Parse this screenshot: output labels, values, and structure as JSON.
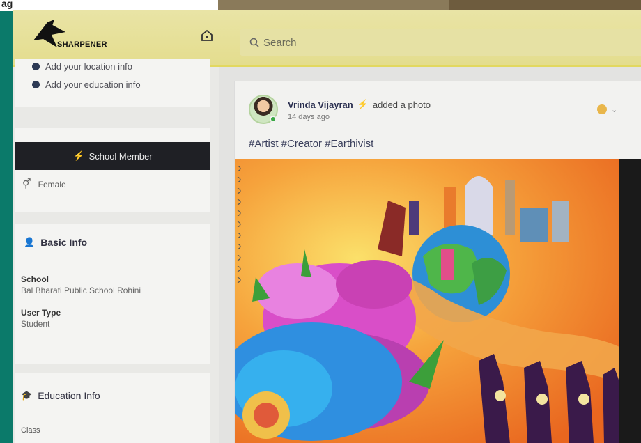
{
  "top_strip": {
    "cut_text": "ag"
  },
  "header": {
    "logo_text": "SHARPENER",
    "search_placeholder": "Search"
  },
  "sidebar": {
    "info_links": [
      {
        "label": "Add your location info"
      },
      {
        "label": "Add your education info"
      }
    ],
    "badge_label": "School Member",
    "gender": "Female",
    "basic_info": {
      "title": "Basic Info",
      "school_label": "School",
      "school_value": "Bal Bharati Public School Rohini",
      "user_type_label": "User Type",
      "user_type_value": "Student"
    },
    "education_info": {
      "title": "Education Info",
      "class_label": "Class"
    }
  },
  "post": {
    "author": "Vrinda Vijayran",
    "action": "added a photo",
    "time": "14 days ago",
    "caption": "#Artist #Creator #Earthivist"
  },
  "colors": {
    "header_yellow": "#e4dd8e",
    "badge_dark": "#1f2025",
    "accent_pink": "#e03c7a",
    "frame_teal": "#0b7a6a"
  }
}
